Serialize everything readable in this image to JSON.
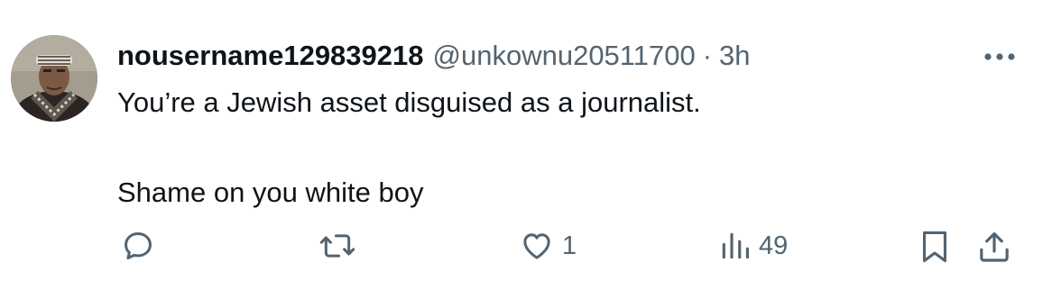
{
  "tweet": {
    "display_name": "nousername129839218",
    "handle": "@unkownu20511700",
    "separator": "·",
    "time": "3h",
    "text_line1": "You’re a Jewish asset disguised as a journalist.",
    "text_line2": "Shame on you white boy"
  },
  "actions": {
    "reply_count": "",
    "retweet_count": "",
    "like_count": "1",
    "views_count": "49"
  },
  "icons": {
    "more": "more-horizontal-icon",
    "reply": "reply-icon",
    "retweet": "retweet-icon",
    "like": "heart-icon",
    "views": "views-chart-icon",
    "bookmark": "bookmark-icon",
    "share": "share-icon"
  },
  "colors": {
    "text_primary": "#0f1419",
    "text_secondary": "#536471",
    "background": "#ffffff"
  }
}
